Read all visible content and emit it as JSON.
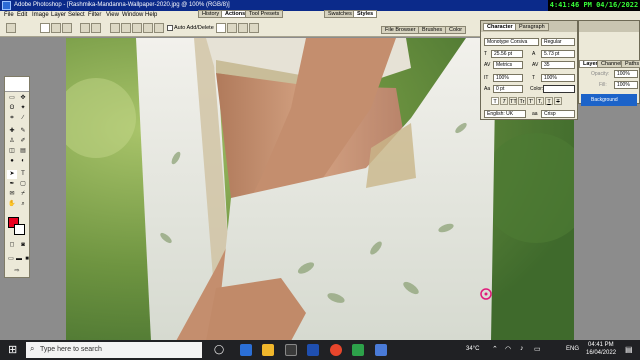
{
  "window": {
    "title": "Adobe Photoshop - [Rashmika-Mandanna-Wallpaper-2020.jpg @ 100% (RGB/8)]"
  },
  "clock_overlay": "4:41:46 PM 04/16/2022",
  "menu": [
    "File",
    "Edit",
    "Image",
    "Layer",
    "Select",
    "Filter",
    "View",
    "Window",
    "Help"
  ],
  "options_bar": {
    "antialias_label": "Auto Add/Delete"
  },
  "palette_well": {
    "group1": [
      "History",
      "Actions",
      "Tool Presets"
    ],
    "group2": [
      "Swatches",
      "Styles"
    ],
    "group3": [
      "File Browser",
      "Brushes",
      "Color"
    ]
  },
  "character_panel": {
    "tabs": [
      "Character",
      "Paragraph"
    ],
    "font_family": "Monotype Corsiva",
    "font_style": "Regular",
    "font_size": "25.56 pt",
    "leading": "5.73 pt",
    "kerning": "Metrics",
    "tracking": "35",
    "vertical_scale": "100%",
    "horizontal_scale": "100%",
    "baseline_shift": "0 pt",
    "color_label": "Color:",
    "language": "English: UK",
    "antialias": "Crisp",
    "type_buttons": [
      "T",
      "T",
      "TT",
      "Tr",
      "T'",
      "T,",
      "T",
      "T"
    ]
  },
  "layers_panel": {
    "tabs": [
      "Layers",
      "Channels",
      "Paths"
    ],
    "opacity_label": "Opacity:",
    "opacity_value": "100%",
    "fill_label": "Fill:",
    "fill_value": "100%",
    "layer_name": "Background"
  },
  "taskbar": {
    "search_placeholder": "Type here to search",
    "weather": "34°C",
    "language": "ENG",
    "time": "04:41 PM",
    "date": "16/04/2022"
  }
}
